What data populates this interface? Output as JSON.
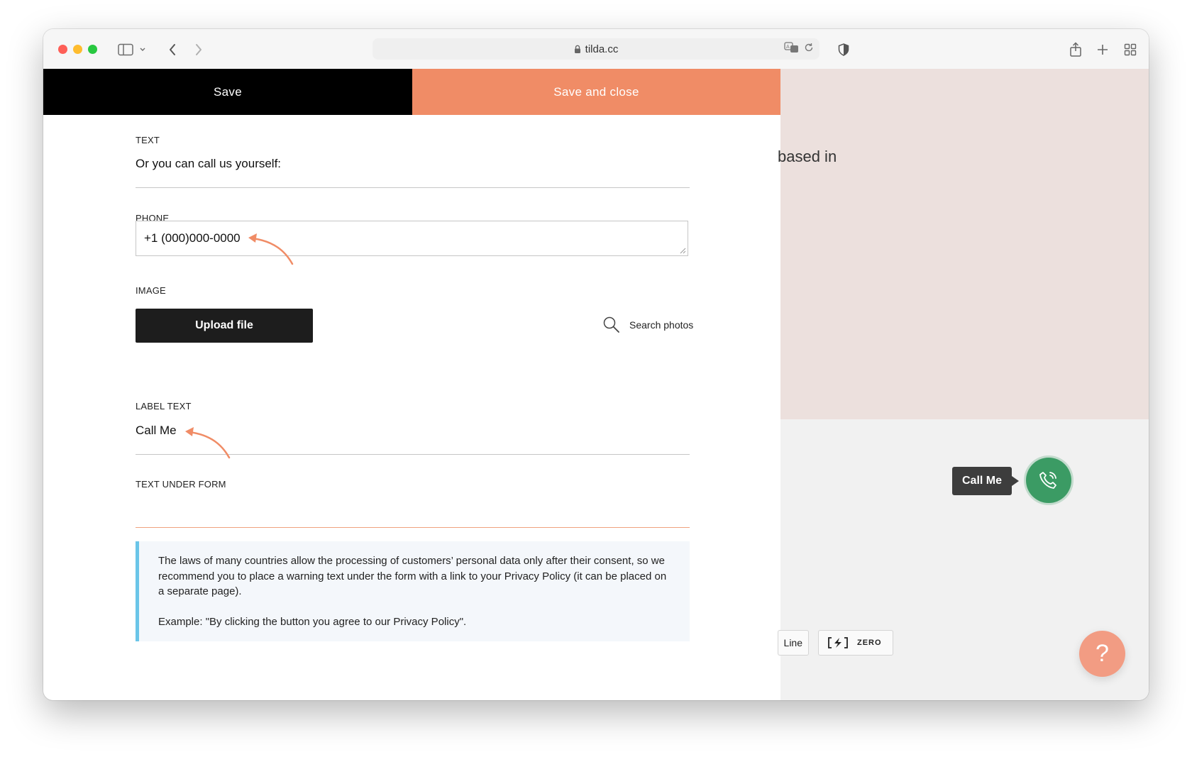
{
  "browser": {
    "url": "tilda.cc"
  },
  "editor": {
    "save_label": "Save",
    "save_close_label": "Save and close",
    "text_label": "TEXT",
    "text_value": "Or you can call us yourself:",
    "phone_label": "PHONE",
    "phone_value": "+1 (000)000-0000",
    "image_label": "IMAGE",
    "upload_label": "Upload file",
    "search_photos_label": "Search photos",
    "label_text_label": "LABEL TEXT",
    "label_text_value": "Call Me",
    "under_form_label": "TEXT UNDER FORM",
    "under_form_value": "",
    "notice_para1": "The laws of many countries allow the processing of customers’ personal data only after their consent, so we recommend you to place a warning text under the form with a link to your Privacy Policy (it can be placed on a separate page).",
    "notice_para2": "Example: \"By clicking the button you agree to our Privacy Policy\"."
  },
  "preview": {
    "partial_text": "based in",
    "callme_label": "Call Me",
    "line_button_label": "Line",
    "zero_button_label": "ZERO",
    "help_label": "?"
  },
  "colors": {
    "accent": "#f08c66",
    "call_green": "#3b9b64",
    "notice_border": "#6ac5e8",
    "help": "#f29c83"
  }
}
